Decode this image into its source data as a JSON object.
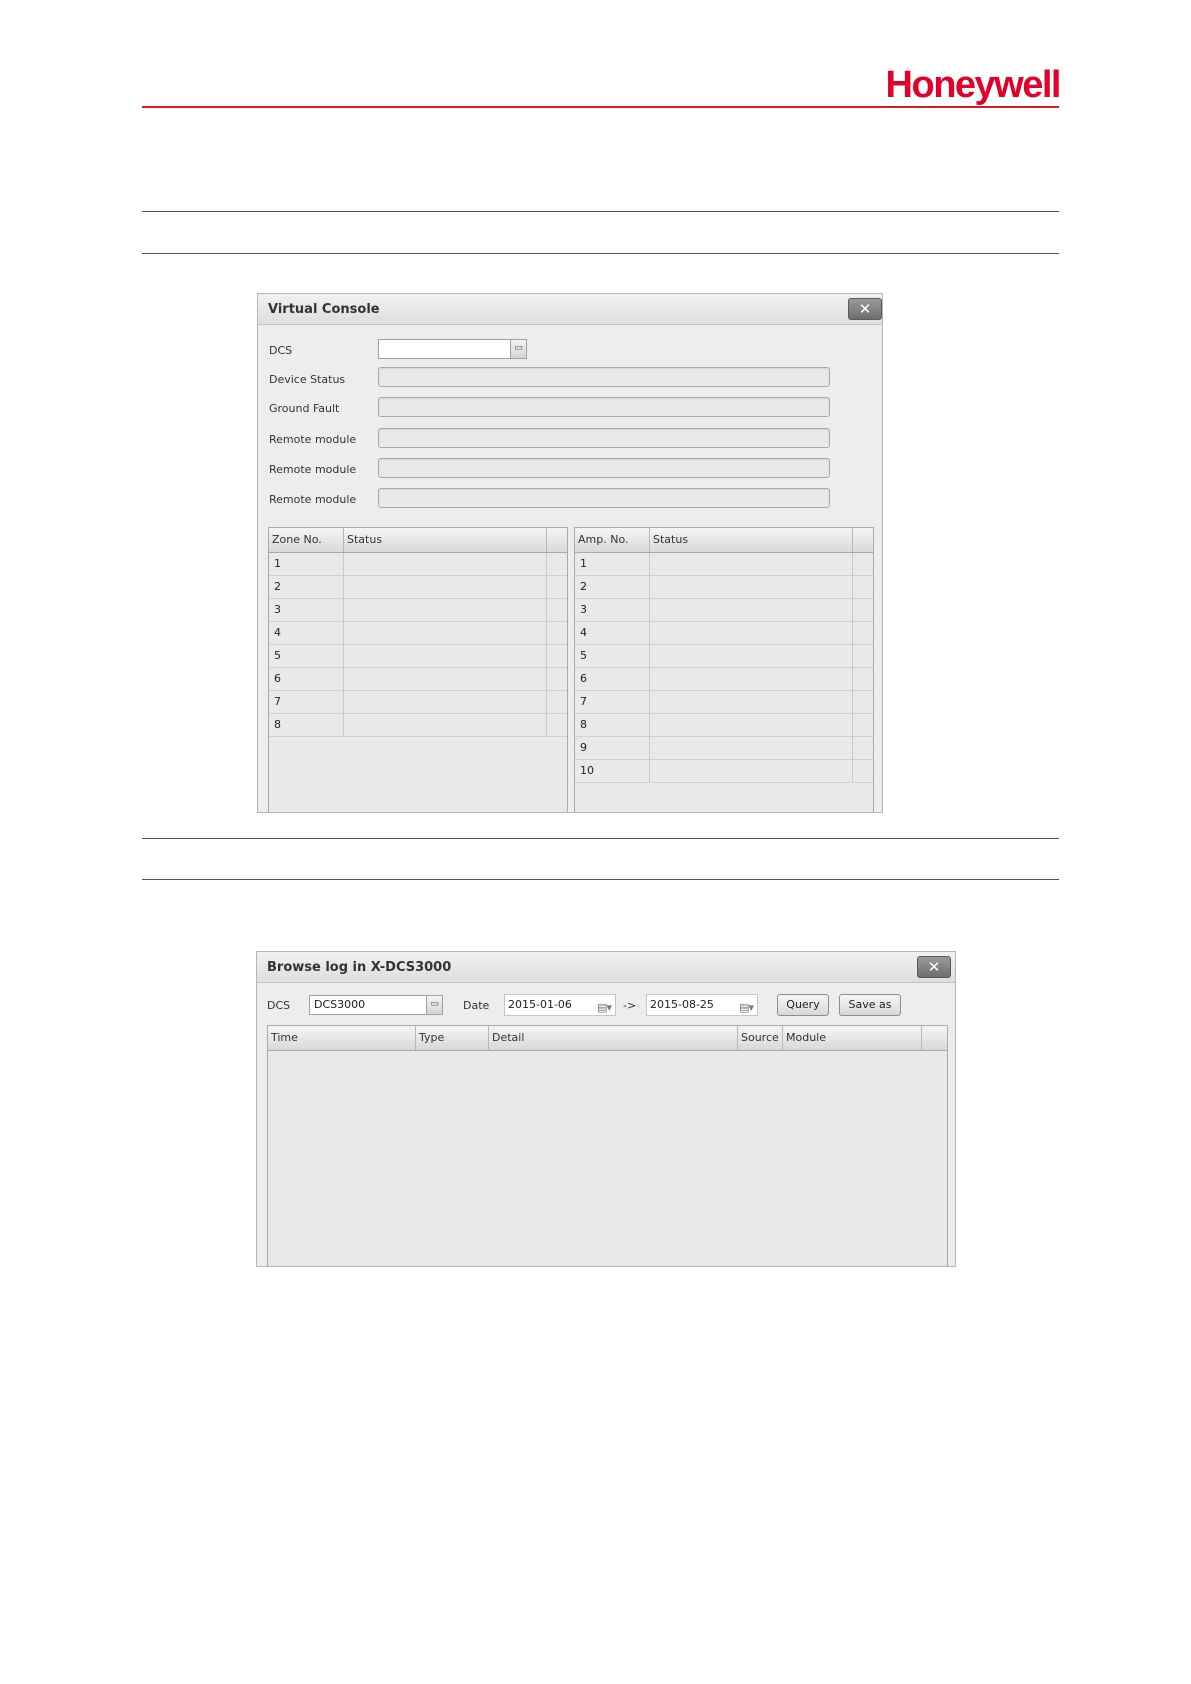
{
  "brand": {
    "name": "Honeywell"
  },
  "virtual_console": {
    "title": "Virtual Console",
    "close_symbol": "✕",
    "fields": [
      {
        "label": "DCS",
        "value": ""
      },
      {
        "label": "Device Status",
        "value": ""
      },
      {
        "label": "Ground Fault",
        "value": ""
      },
      {
        "label": "Remote module",
        "value": ""
      },
      {
        "label": "Remote module",
        "value": ""
      },
      {
        "label": "Remote module",
        "value": ""
      }
    ],
    "zone_table": {
      "headers": [
        "Zone No.",
        "Status"
      ],
      "rows": [
        "1",
        "2",
        "3",
        "4",
        "5",
        "6",
        "7",
        "8"
      ]
    },
    "amp_table": {
      "headers": [
        "Amp. No.",
        "Status"
      ],
      "rows": [
        "1",
        "2",
        "3",
        "4",
        "5",
        "6",
        "7",
        "8",
        "9",
        "10"
      ]
    }
  },
  "browse_log": {
    "title": "Browse log in X-DCS3000",
    "close_symbol": "✕",
    "dcs_label": "DCS",
    "dcs_value": "DCS3000",
    "date_label": "Date",
    "date_from": "2015-01-06",
    "arrow": "->",
    "date_to": "2015-08-25",
    "query_label": "Query",
    "save_label": "Save as",
    "columns": [
      "Time",
      "Type",
      "Detail",
      "Source",
      "Module"
    ]
  }
}
